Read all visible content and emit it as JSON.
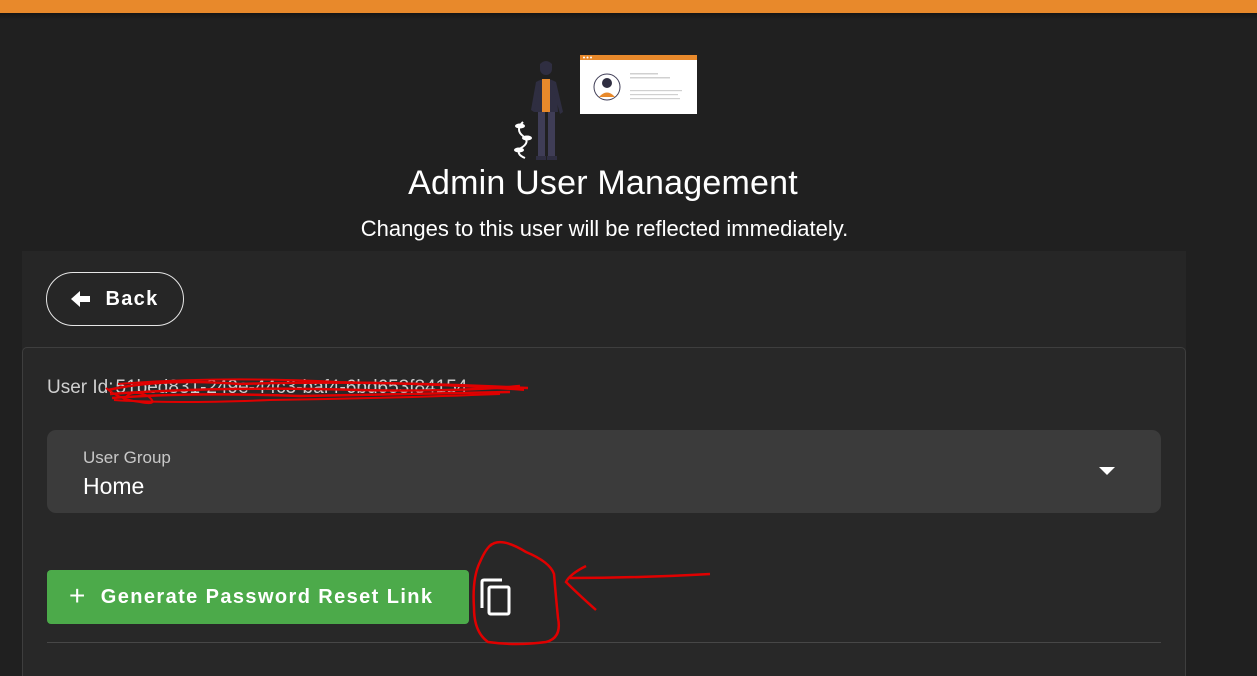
{
  "header": {
    "title": "Admin User Management",
    "subtitle": "Changes to this user will be reflected immediately.",
    "accent_color": "#e8892b"
  },
  "nav": {
    "back_label": "Back",
    "back_icon": "arrow-left-icon"
  },
  "user": {
    "id_label": "User Id:",
    "id_value": "51bed831-249e-44c3-baf4-6bd653f84154"
  },
  "user_group": {
    "label": "User Group",
    "value": "Home",
    "icon": "chevron-down-icon"
  },
  "actions": {
    "generate_label": "Generate Password Reset Link",
    "generate_icon": "plus-icon",
    "generate_color": "#4caa4a",
    "copy_icon": "copy-icon"
  },
  "annotation_color": "#e00000"
}
